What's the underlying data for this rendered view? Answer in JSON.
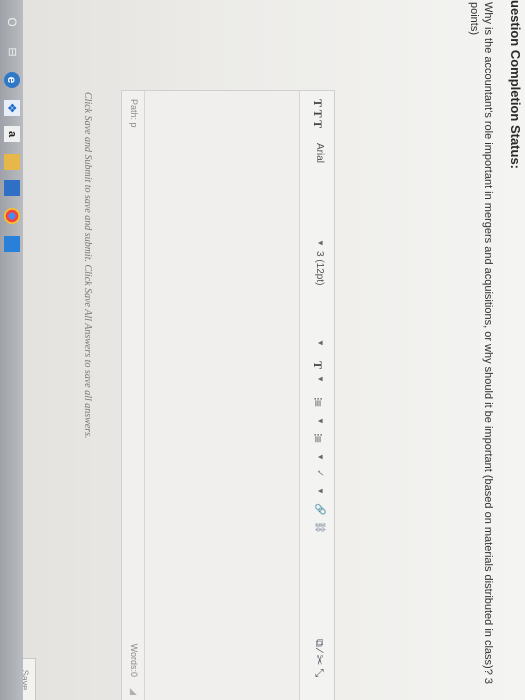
{
  "page": {
    "status_heading": "uestion Completion Status:",
    "question": "Why is the accountant's role important in mergers and acquisitions, or why should it be important (based on materials distributed in class)? 3 points)"
  },
  "editor": {
    "toolbar": {
      "bold_icons": "T T T",
      "font_family": "Arial",
      "font_size": "3 (12pt)",
      "caret": "▼",
      "text_color": "T",
      "bullet_list": "⁝≡",
      "numbered_list": "⁝≡",
      "spellcheck": "✓",
      "link": "🔗",
      "unlink": "⛓",
      "right_tools": "⧉ ⁄ ✂ ⤡"
    },
    "path_label": "Path: p",
    "word_count_label": "Words:0",
    "resize": "◢"
  },
  "footer": {
    "note": "Click Save and Submit to save and submit. Click Save All Answers to save all answers.",
    "save_button": "Save"
  },
  "taskbar": {
    "search": "O",
    "task_view": "⊟",
    "edge": "e",
    "dropbox": "❖",
    "amazon": "a",
    "folder": "",
    "mail": "",
    "chrome": "",
    "store": ""
  }
}
